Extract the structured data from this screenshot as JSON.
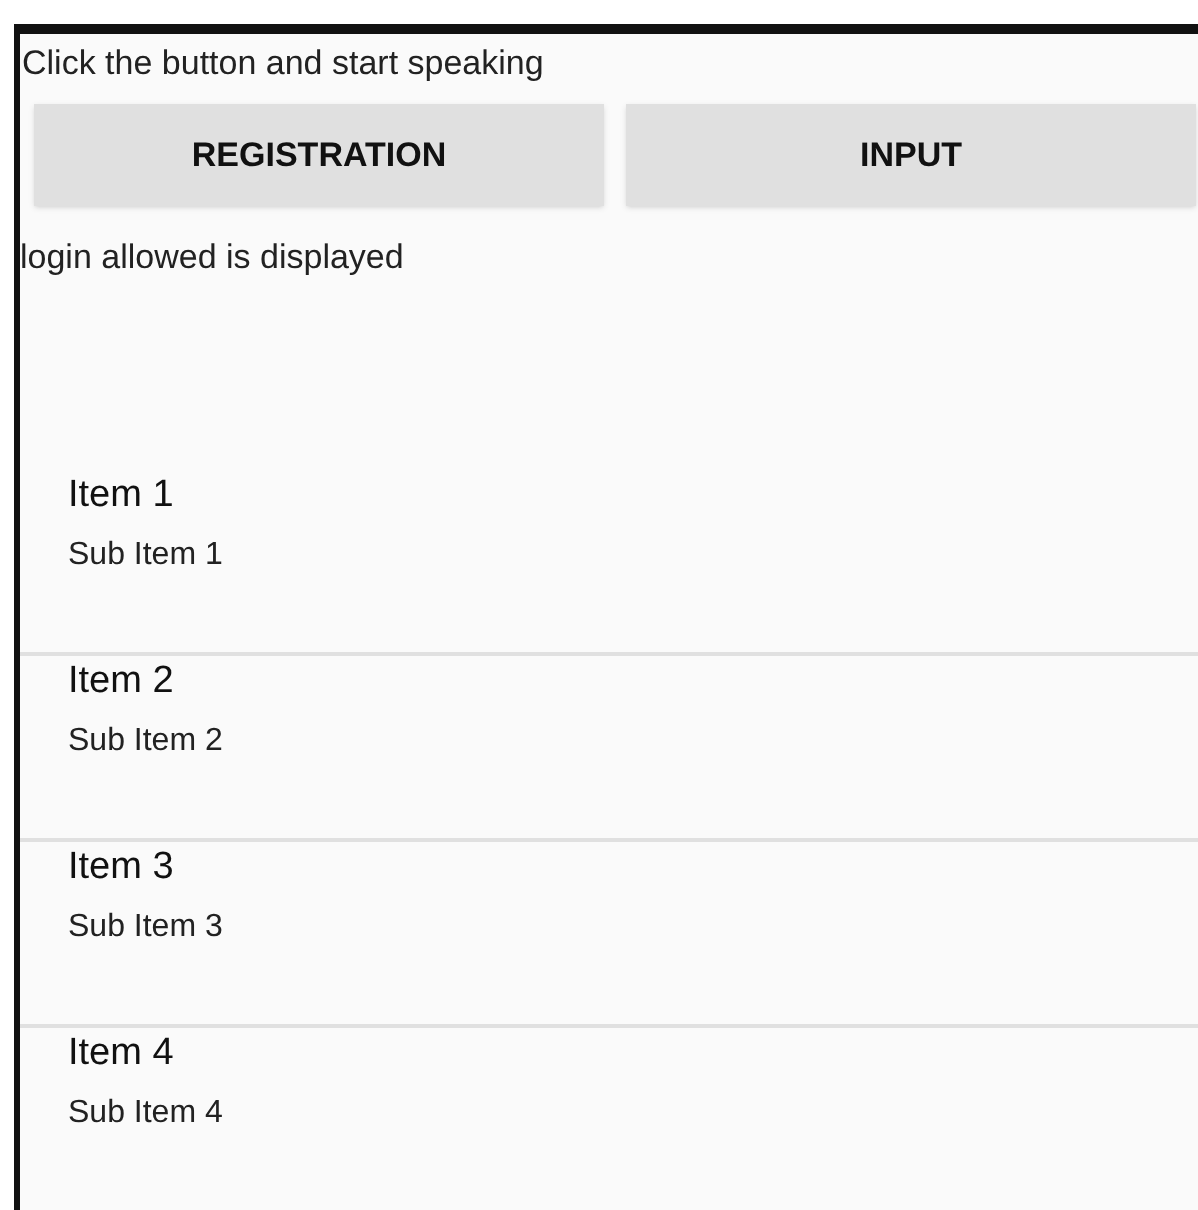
{
  "instruction": "Click the button and start speaking",
  "buttons": [
    "REGISTRATION",
    "INPUT"
  ],
  "status": "login allowed is displayed",
  "list": [
    {
      "title": "Item 1",
      "subtitle": "Sub Item 1"
    },
    {
      "title": "Item 2",
      "subtitle": "Sub Item 2"
    },
    {
      "title": "Item 3",
      "subtitle": "Sub Item 3"
    },
    {
      "title": "Item 4",
      "subtitle": "Sub Item 4"
    }
  ]
}
